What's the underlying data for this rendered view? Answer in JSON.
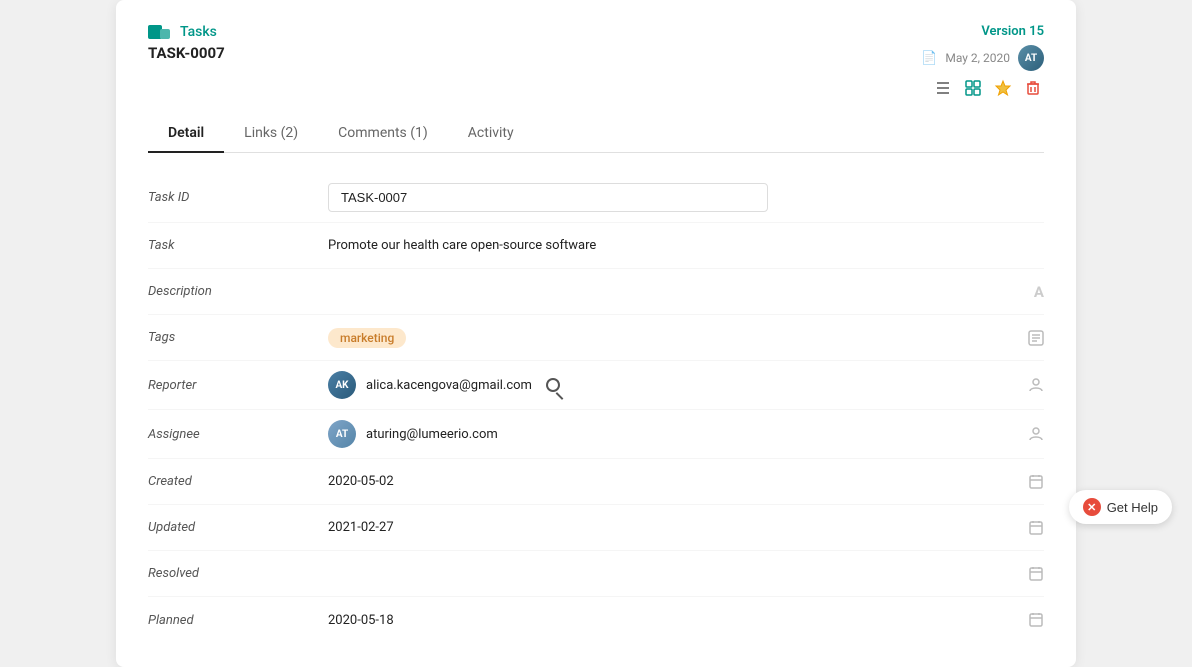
{
  "header": {
    "breadcrumb_icon": "tasks-icon",
    "breadcrumb_label": "Tasks",
    "task_id_label": "TASK-0007",
    "version": "Version 15",
    "date": "May 2, 2020",
    "avatar_initials": "AT"
  },
  "tabs": [
    {
      "label": "Detail",
      "active": true
    },
    {
      "label": "Links (2)",
      "active": false
    },
    {
      "label": "Comments (1)",
      "active": false
    },
    {
      "label": "Activity",
      "active": false
    }
  ],
  "fields": [
    {
      "label": "Task ID",
      "type": "input",
      "value": "TASK-0007",
      "icon": "none"
    },
    {
      "label": "Task",
      "type": "text",
      "value": "Promote our health care open-source software",
      "icon": "none"
    },
    {
      "label": "Description",
      "type": "text",
      "value": "",
      "icon": "font-icon"
    },
    {
      "label": "Tags",
      "type": "tag",
      "value": "marketing",
      "icon": "tag-icon"
    },
    {
      "label": "Reporter",
      "type": "user",
      "value": "alica.kacengova@gmail.com",
      "avatar": "alica",
      "icon": "person-icon"
    },
    {
      "label": "Assignee",
      "type": "user",
      "value": "aturing@lumeerio.com",
      "avatar": "aturing",
      "icon": "person-icon"
    },
    {
      "label": "Created",
      "type": "text",
      "value": "2020-05-02",
      "icon": "calendar-icon"
    },
    {
      "label": "Updated",
      "type": "text",
      "value": "2021-02-27",
      "icon": "calendar-icon"
    },
    {
      "label": "Resolved",
      "type": "text",
      "value": "",
      "icon": "calendar-icon"
    },
    {
      "label": "Planned",
      "type": "text",
      "value": "2020-05-18",
      "icon": "calendar-icon"
    }
  ],
  "help_button": "Get Help"
}
